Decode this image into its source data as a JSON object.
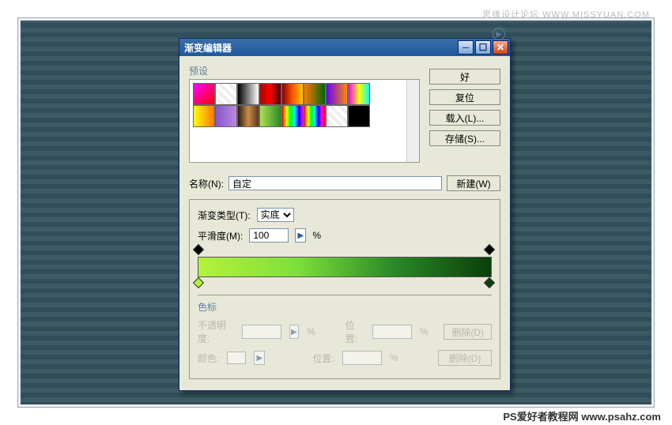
{
  "watermarks": {
    "top": "思缘设计论坛 WWW.MISSYUAN.COM",
    "bottom": "PS爱好者教程网  www.psahz.com"
  },
  "dialog": {
    "title": "渐变编辑器",
    "presets_label": "预设",
    "buttons": {
      "ok": "好",
      "reset": "复位",
      "load": "载入(L)...",
      "save": "存储(S)...",
      "new": "新建(W)"
    },
    "name_label": "名称(N):",
    "name_value": "自定",
    "type_label": "渐变类型(T):",
    "type_value": "实底",
    "smoothness_label": "平滑度(M):",
    "smoothness_value": "100",
    "percent": "%",
    "stops_label": "色标",
    "opacity_label": "不透明度:",
    "position_label": "位置:",
    "color_label": "颜色:",
    "delete_label": "删除(D)",
    "gradient": {
      "left": "#b3f23a",
      "right": "#0b3f0a"
    },
    "swatches": [
      "linear-gradient(135deg,#f0f,#f00)",
      "repeating-linear-gradient(45deg,#fff 0 4px,#eee 4px 8px)",
      "linear-gradient(90deg,#000,#fff)",
      "linear-gradient(90deg,#a00,#f00,#400)",
      "linear-gradient(90deg,#800,#f50,#fc0)",
      "linear-gradient(90deg,#f70,#060)",
      "linear-gradient(90deg,#60f,#f80)",
      "linear-gradient(90deg,#f0f,#ff0,#0ff)",
      "linear-gradient(90deg,#ff0,#f70)",
      "linear-gradient(90deg,#85c,#b8d)",
      "linear-gradient(90deg,#2a1e0f,#c98b48,#5a3a1f)",
      "linear-gradient(90deg,#b0e050,#2a8a26)",
      "linear-gradient(90deg,#f00,#ff0,#0f0,#0ff,#00f,#f0f)",
      "linear-gradient(90deg,#f00,#ff0,#0f0,#0ff,#00f,#f0f,#f00)",
      "repeating-linear-gradient(45deg,#fff 0 4px,#eee 4px 8px)",
      "linear-gradient(90deg,#000,#000)"
    ]
  }
}
